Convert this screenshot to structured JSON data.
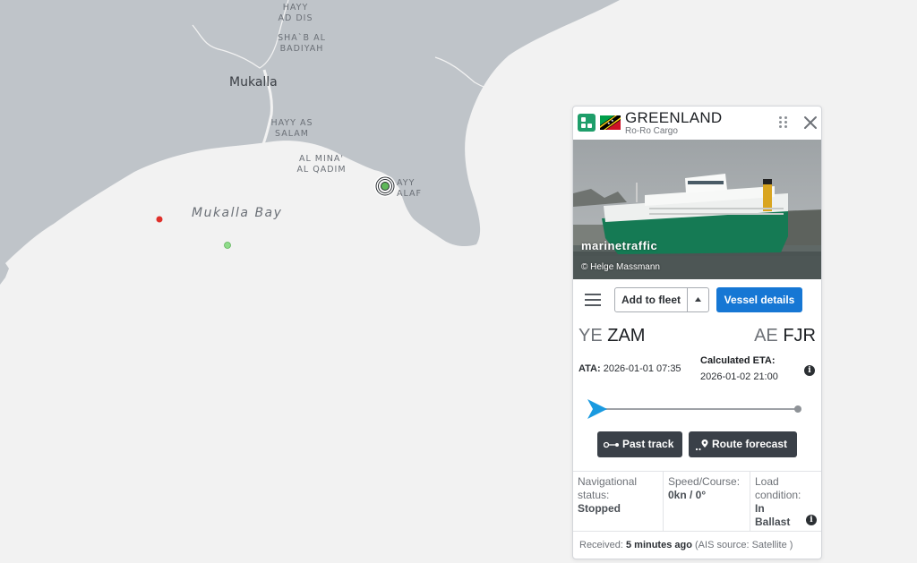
{
  "map": {
    "labels": {
      "hayy_ad_dis": "HAYY\nAD DIS",
      "shab_al_badiyah": "SHA`B AL\nBADIYAH",
      "mukalla": "Mukalla",
      "hayy_as_salam": "HAYY AS\nSALAM",
      "al_mina_al_qadim": "AL MINA'\nAL QADIM",
      "hayy_khalaf": "AYY\nALAF",
      "mukalla_bay": "Mukalla Bay"
    },
    "colors": {
      "land": "#bfc4c9",
      "water": "#f2f2f2",
      "vessel_red": "#e0302b",
      "vessel_green": "#8fdc8a"
    }
  },
  "card": {
    "vessel_name": "GREENLAND",
    "vessel_type": "Ro-Ro Cargo",
    "flag": "Saint Kitts and Nevis",
    "watermark": "marinetraffic",
    "photo_credit": "© Helge Massmann",
    "add_to_fleet": "Add to fleet",
    "vessel_details": "Vessel details",
    "origin": {
      "country": "YE",
      "port": "ZAM"
    },
    "destination": {
      "country": "AE",
      "port": "FJR"
    },
    "ata_label": "ATA:",
    "ata_value": "2026-01-01 07:35",
    "eta_label": "Calculated ETA:",
    "eta_value": "2026-01-02 21:00",
    "progress": 0.0,
    "past_track": "Past track",
    "route_forecast": "Route forecast",
    "nav_status_label": "Navigational status:",
    "nav_status_value": "Stopped",
    "speed_label": "Speed/Course:",
    "speed_value": "0kn / 0°",
    "load_label": "Load condition:",
    "load_value": "In Ballast",
    "received_label": "Received:",
    "received_value": "5 minutes ago",
    "ais_source": "(AIS source: Satellite )",
    "accent_color": "#1677d4"
  }
}
